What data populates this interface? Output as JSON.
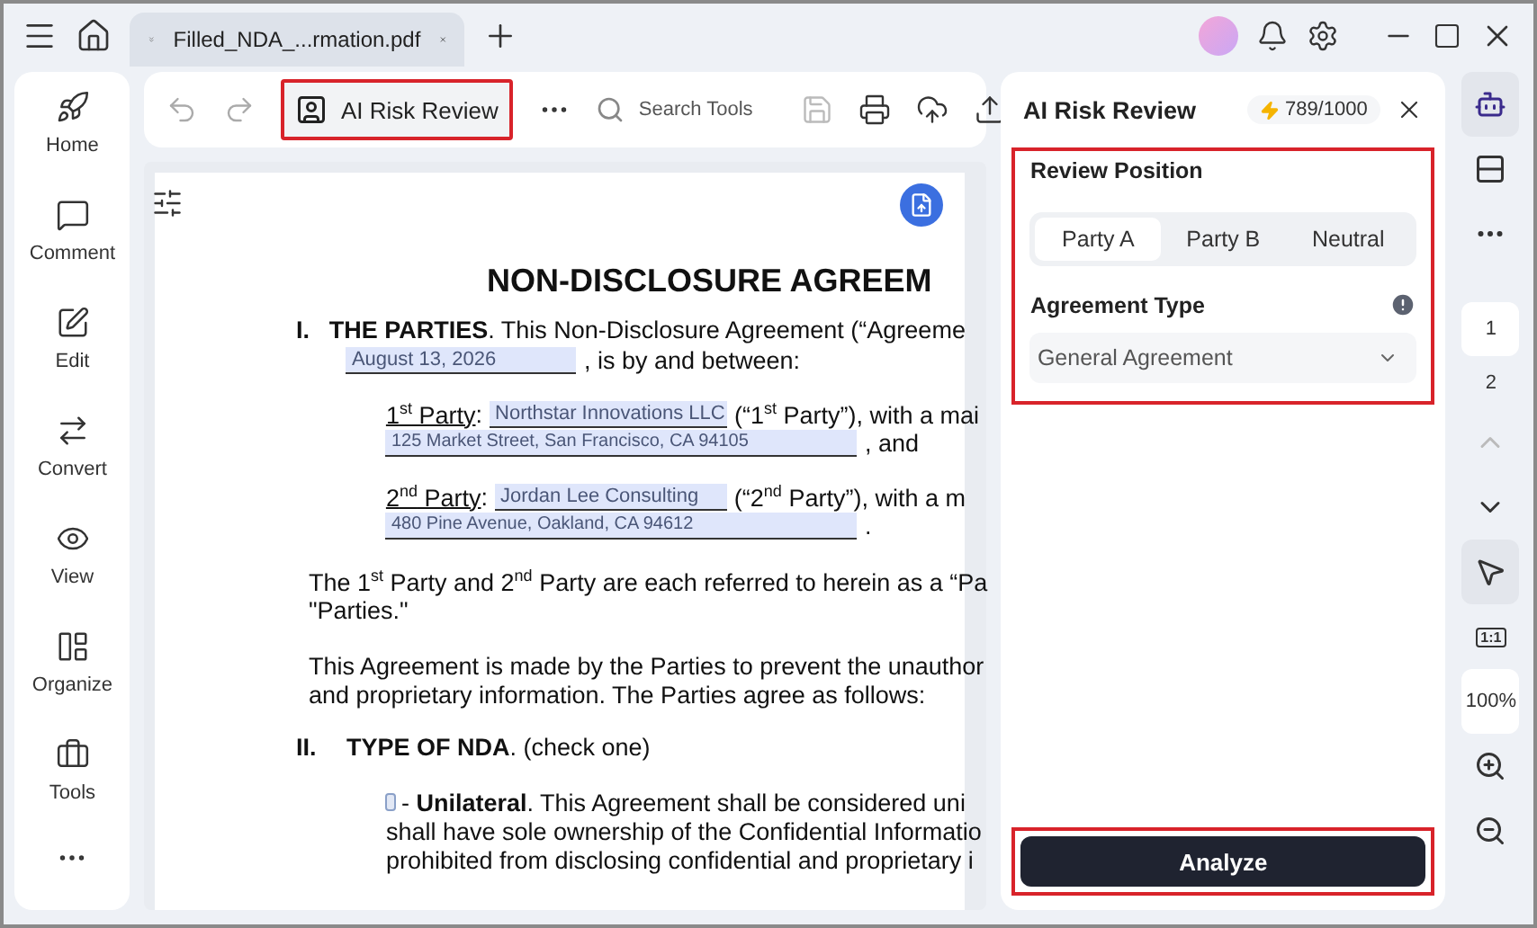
{
  "titlebar": {
    "tab": {
      "label": "Filled_NDA_...rmation.pdf",
      "selected": true
    }
  },
  "sidebar": {
    "items": [
      {
        "label": "Home"
      },
      {
        "label": "Comment"
      },
      {
        "label": "Edit"
      },
      {
        "label": "Convert"
      },
      {
        "label": "View"
      },
      {
        "label": "Organize"
      },
      {
        "label": "Tools"
      }
    ]
  },
  "toolbar": {
    "ai_button": {
      "label": "AI Risk Review",
      "highlighted": true
    },
    "search": {
      "placeholder": "Search Tools"
    }
  },
  "document": {
    "title": "NON-DISCLOSURE AGREEM",
    "section_1": {
      "number": "I.",
      "text": "**THE PARTIES**. This Non-Disclosure Agreement (“Agreeme",
      "date_field": "August 13, 2026",
      "date_after": ", is by and between:"
    },
    "parties": [
      {
        "label": "1$^{st}$ Party",
        "label_end": ":",
        "name_field": "Northstar Innovations LLC",
        "after": "(“1$^{st}$ Party”), with a mai",
        "address_field": "125 Market Street, San Francisco, CA 94105",
        "address_after": ", and"
      },
      {
        "label": "2$^{nd}$ Party",
        "label_end": ":",
        "name_field": "Jordan Lee Consulting",
        "after": "(“2$^{nd}$ Party”), with a m",
        "address_field": "480 Pine Avenue, Oakland, CA 94612",
        "address_after": "."
      }
    ],
    "paragraphs": [
      [
        "The 1$^{st}$ Party and 2$^{nd}$ Party are each referred to herein as a “Pa",
        "\"Parties.\""
      ],
      [
        "This Agreement is made by the Parties to prevent the unauthor",
        "and proprietary information. The Parties agree as follows:"
      ]
    ],
    "section_2": {
      "number": "II.",
      "text": "**TYPE OF NDA**. (check one)"
    },
    "option": {
      "checked": false,
      "lines": [
        "- **Unilateral**. This Agreement shall be considered uni",
        "shall have sole ownership of the Confidential Informatio",
        "prohibited from disclosing confidential and proprietary i"
      ]
    }
  },
  "panel": {
    "title": "AI Risk Review",
    "credits": "789/1000",
    "section": {
      "highlighted": true,
      "review_label": "Review Position",
      "positions": [
        {
          "label": "Party A",
          "selected": true
        },
        {
          "label": "Party B",
          "selected": false
        },
        {
          "label": "Neutral",
          "selected": false
        }
      ],
      "type_label": "Agreement Type",
      "type_value": "General Agreement"
    },
    "analyze": {
      "label": "Analyze",
      "highlighted": true
    }
  },
  "rail": {
    "pages": [
      {
        "label": "1",
        "selected": true
      },
      {
        "label": "2",
        "selected": false
      }
    ],
    "fit_label": "1:1",
    "zoom": "100%"
  }
}
